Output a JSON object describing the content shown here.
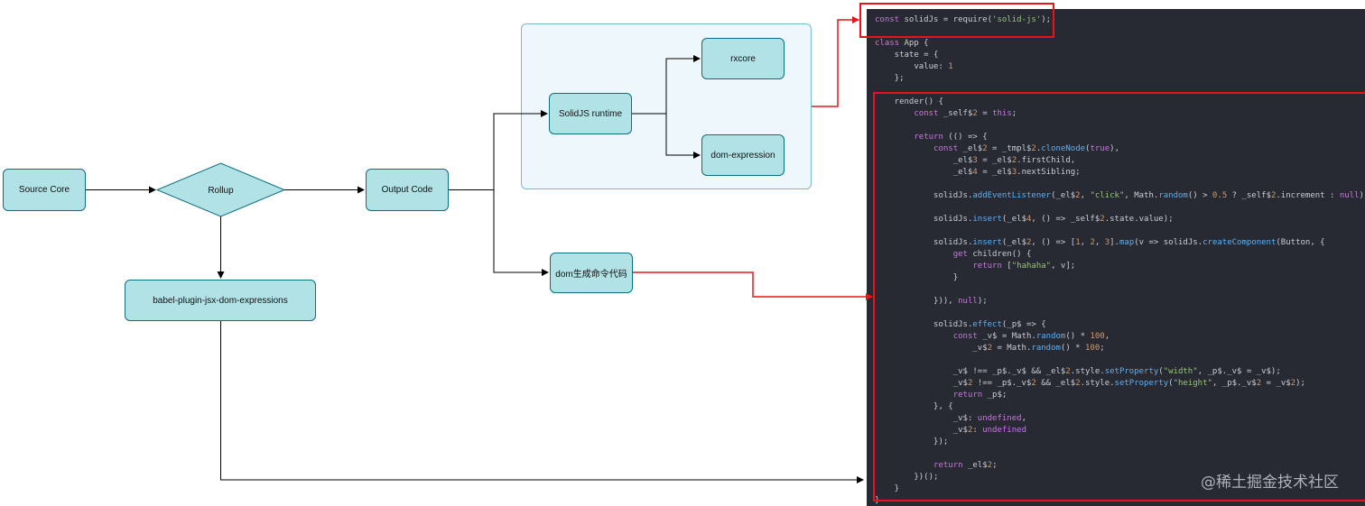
{
  "nodes": {
    "source_core": "Source Core",
    "rollup": "Rollup",
    "output_code": "Output Code",
    "solidjs_runtime": "SolidJS runtime",
    "rxcore": "rxcore",
    "dom_expression": "dom-expression",
    "dom_codegen": "dom生成命令代码",
    "babel_plugin": "babel-plugin-jsx-dom-expressions"
  },
  "colors": {
    "node_fill": "#b1e2e6",
    "node_border": "#0f6d7e",
    "group_fill": "#eef7fb",
    "group_border": "#7fb5cc",
    "highlight": "#e8131b",
    "code_bg": "#282a33"
  },
  "code": {
    "lines": [
      "const solidJs = require('solid-js');",
      "",
      "class App {",
      "    state = {",
      "        value: 1",
      "    };",
      "",
      "    render() {",
      "        const _self$2 = this;",
      "",
      "        return (() => {",
      "            const _el$2 = _tmpl$2.cloneNode(true),",
      "                _el$3 = _el$2.firstChild,",
      "                _el$4 = _el$3.nextSibling;",
      "",
      "            solidJs.addEventListener(_el$2, \"click\", Math.random() > 0.5 ? _self$2.increment : null);",
      "",
      "            solidJs.insert(_el$4, () => _self$2.state.value);",
      "",
      "            solidJs.insert(_el$2, () => [1, 2, 3].map(v => solidJs.createComponent(Button, {",
      "                get children() {",
      "                    return [\"hahaha\", v];",
      "                }",
      "",
      "            })), null);",
      "",
      "            solidJs.effect(_p$ => {",
      "                const _v$ = Math.random() * 100,",
      "                    _v$2 = Math.random() * 100;",
      "",
      "                _v$ !== _p$._v$ && _el$2.style.setProperty(\"width\", _p$._v$ = _v$);",
      "                _v$2 !== _p$._v$2 && _el$2.style.setProperty(\"height\", _p$._v$2 = _v$2);",
      "                return _p$;",
      "            }, {",
      "                _v$: undefined,",
      "                _v$2: undefined",
      "            });",
      "",
      "            return _el$2;",
      "        })();",
      "    }",
      "}"
    ]
  },
  "watermark": "@稀土掘金技术社区"
}
